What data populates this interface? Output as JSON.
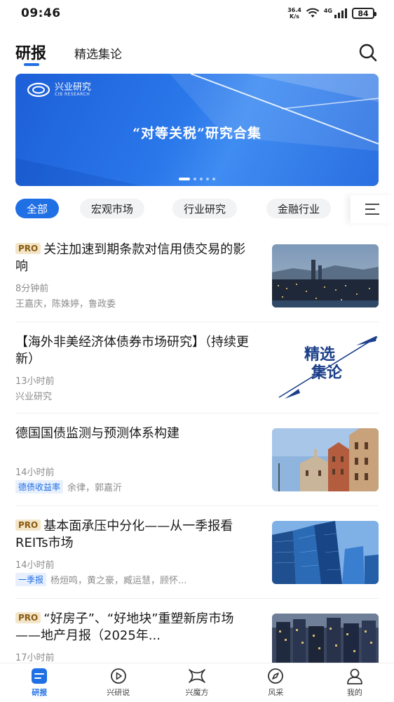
{
  "status_bar": {
    "time": "09:46",
    "net_speed_value": "36.4",
    "net_speed_unit": "K/s",
    "signal_label": "4G",
    "battery": "84"
  },
  "header": {
    "tab_active": "研报",
    "tab_second": "精选集论",
    "accent_color": "#1f6fe5"
  },
  "banner": {
    "logo_text": "兴业研究",
    "logo_sub": "CIB RESEARCH",
    "title": "“对等关税”研究合集",
    "page_count": 5,
    "active_page": 1
  },
  "categories": {
    "items": [
      "全部",
      "宏观市场",
      "行业研究",
      "金融行业"
    ],
    "active": "全部"
  },
  "articles": [
    {
      "pro": "PRO",
      "title": "关注加速到期条款对信用债交易的影响",
      "time": "8分钟前",
      "tag": "",
      "authors": "王嘉庆，陈姝婷，鲁政委",
      "thumb": "city-night-skyline"
    },
    {
      "pro": "",
      "title": "【海外非美经济体债券市场研究】（持续更新）",
      "time": "13小时前",
      "tag": "",
      "authors": "兴业研究",
      "thumb": "jingxuan-jilun-logo",
      "thumb_text_1": "精选",
      "thumb_text_2": "集论"
    },
    {
      "pro": "",
      "title": "德国国债监测与预测体系构建",
      "time": "14小时前",
      "tag": "德债收益率",
      "authors": "余律，郭嘉沂",
      "thumb": "european-buildings"
    },
    {
      "pro": "PRO",
      "title": "基本面承压中分化——从一季报看REITs市场",
      "time": "14小时前",
      "tag": "一季报",
      "authors": "杨烜鸣，黄之豪，臧运慧，顾怀...",
      "thumb": "glass-skyscrapers"
    },
    {
      "pro": "PRO",
      "title": "“好房子”、“好地块”重塑新房市场——地产月报（2025年...",
      "time": "17小时前",
      "tag": "",
      "authors": "",
      "thumb": "city-night-buildings"
    }
  ],
  "bottom_nav": [
    {
      "label": "研报",
      "icon": "report-icon",
      "active": true
    },
    {
      "label": "兴研说",
      "icon": "play-icon",
      "active": false
    },
    {
      "label": "兴魔方",
      "icon": "cube-icon",
      "active": false
    },
    {
      "label": "风采",
      "icon": "compass-icon",
      "active": false
    },
    {
      "label": "我的",
      "icon": "user-icon",
      "active": false
    }
  ]
}
